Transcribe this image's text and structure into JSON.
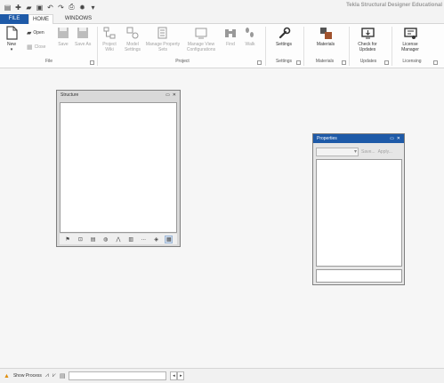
{
  "app": {
    "title": "Tekla Structural Designer Educational"
  },
  "quick_access": [
    {
      "name": "app-menu-icon",
      "glyph": "▤"
    },
    {
      "name": "new-file-icon",
      "glyph": "✚"
    },
    {
      "name": "open-folder-icon",
      "glyph": "▰"
    },
    {
      "name": "save-icon",
      "glyph": "▣"
    },
    {
      "name": "undo-icon",
      "glyph": "↶"
    },
    {
      "name": "redo-icon",
      "glyph": "↷"
    },
    {
      "name": "print-icon",
      "glyph": "⎙"
    },
    {
      "name": "settings-icon",
      "glyph": "✹"
    },
    {
      "name": "customize-dropdown-icon",
      "glyph": "▾"
    }
  ],
  "tabs": {
    "file": "FILE",
    "home": "HOME",
    "windows": "WINDOWS"
  },
  "ribbon": {
    "new": "New",
    "open": "Open",
    "close": "Close",
    "save": "Save",
    "save_as": "Save As",
    "project_wiki": "Project Wiki",
    "model_settings": "Model Settings",
    "manage_property_sets": "Manage Property Sets",
    "manage_view_configurations": "Manage View Configurations",
    "find": "Find",
    "walk": "Walk",
    "settings": "Settings",
    "materials": "Materials",
    "check_updates": "Check for Updates",
    "license_manager": "License Manager",
    "groups": {
      "file": "File",
      "project": "Project",
      "settings": "Settings",
      "materials": "Materials",
      "updates": "Updates",
      "licensing": "Licensing"
    }
  },
  "structure_panel": {
    "title": "Structure",
    "more": "..."
  },
  "properties_panel": {
    "title": "Properties",
    "save": "Save...",
    "apply": "Apply..."
  },
  "status_bar": {
    "show_process": "Show Process"
  },
  "colors": {
    "accent": "#1e5aa8",
    "warning": "#e08e0b"
  }
}
